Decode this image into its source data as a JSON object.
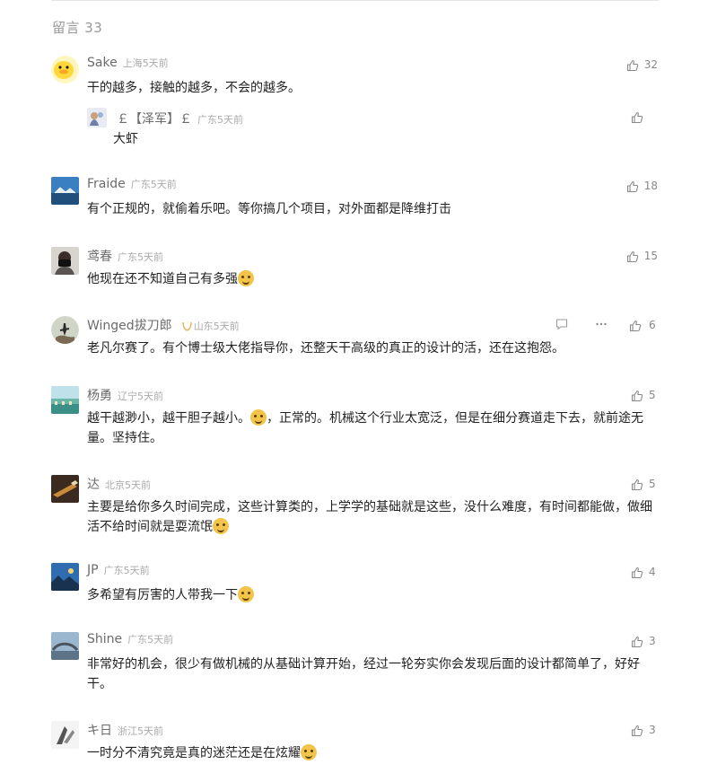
{
  "section": {
    "title": "留言 33"
  },
  "comments": [
    {
      "name": "Sake",
      "loc": "上海",
      "time": "5天前",
      "text": "干的越多，接触的越多，不会的越多。",
      "likes": "32"
    },
    {
      "name": "Fraide",
      "loc": "广东",
      "time": "5天前",
      "text": "有个正规的，就偷着乐吧。等你搞几个项目，对外面都是降维打击",
      "likes": "18"
    },
    {
      "name": "鸢春",
      "loc": "广东",
      "time": "5天前",
      "text": "他现在还不知道自己有多强",
      "likes": "15"
    },
    {
      "name": "Winged拔刀郎",
      "loc": "山东",
      "time": "5天前",
      "text": "老凡尔赛了。有个博士级大佬指导你，还整天干高级的真正的设计的活，还在这抱怨。",
      "likes": "6"
    },
    {
      "name": "杨勇",
      "loc": "辽宁",
      "time": "5天前",
      "text_a": "越干越渺小，越干胆子越小。",
      "text_b": "，正常的。机械这个行业太宽泛，但是在细分赛道走下去，就前途无量。坚持住。",
      "likes": "5"
    },
    {
      "name": "达",
      "loc": "北京",
      "time": "5天前",
      "text": "主要是给你多久时间完成，这些计算类的，上学学的基础就是这些，没什么难度，有时间都能做，做细活不给时间就是耍流氓",
      "likes": "5"
    },
    {
      "name": "JP",
      "loc": "广东",
      "time": "5天前",
      "text": "多希望有厉害的人带我一下",
      "likes": "4"
    },
    {
      "name": "Shine",
      "loc": "广东",
      "time": "5天前",
      "text": "非常好的机会，很少有做机械的从基础计算开始，经过一轮夯实你会发现后面的设计都简单了，好好干。",
      "likes": "3"
    },
    {
      "name": "キ日",
      "loc": "浙江",
      "time": "5天前",
      "text": "一时分不清究竟是真的迷茫还是在炫耀",
      "likes": "3"
    }
  ],
  "reply": {
    "name": "￡【泽军】￡",
    "loc": "广东",
    "time": "5天前",
    "text": "大虾",
    "likes": ""
  }
}
